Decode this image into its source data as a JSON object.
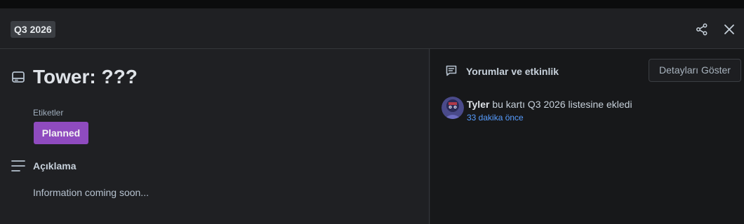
{
  "header": {
    "list_badge": "Q3 2026",
    "share_icon": "share-icon",
    "close_icon": "close-icon"
  },
  "card": {
    "icon": "card-icon",
    "title": "Tower: ???",
    "labels_heading": "Etiketler",
    "label": {
      "text": "Planned",
      "color": "#8f4bbf"
    },
    "description_icon": "description-icon",
    "description_heading": "Açıklama",
    "description_text": "Information coming soon..."
  },
  "activity": {
    "icon": "comment-icon",
    "heading": "Yorumlar ve etkinlik",
    "details_button": "Detayları Göster",
    "entries": [
      {
        "user": "Tyler",
        "action": " bu kartı Q3 2026 listesine ekledi",
        "time": "33 dakika önce",
        "time_color": "#579dff"
      }
    ]
  }
}
